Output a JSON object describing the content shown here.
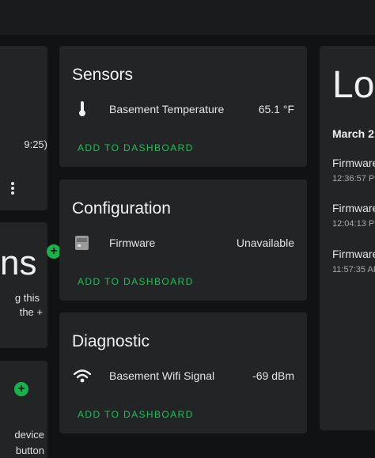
{
  "left": {
    "time_fragment": "9:25)",
    "big_text_fragment": "ns",
    "line1": "g this",
    "line2": "the +",
    "line3": "device",
    "line4": "button"
  },
  "sensors": {
    "title": "Sensors",
    "entity_label": "Basement Temperature",
    "entity_value": "65.1 °F",
    "icon": "thermometer-icon",
    "add_label": "ADD TO DASHBOARD"
  },
  "configuration": {
    "title": "Configuration",
    "entity_label": "Firmware",
    "entity_value": "Unavailable",
    "icon": "firmware-icon",
    "add_label": "ADD TO DASHBOARD"
  },
  "diagnostic": {
    "title": "Diagnostic",
    "entity_label": "Basement Wifi Signal",
    "entity_value": "-69 dBm",
    "icon": "wifi-icon",
    "add_label": "ADD TO DASHBOARD"
  },
  "logbook": {
    "title_fragment": "Lo",
    "date_fragment": "March 2",
    "entries": [
      {
        "name": "Firmware",
        "time": "12:36:57 PI"
      },
      {
        "name": "Firmware",
        "time": "12:04:13 PI"
      },
      {
        "name": "Firmware",
        "time": "11:57:35 AI"
      }
    ]
  },
  "colors": {
    "background": "#111213",
    "card": "#222425",
    "accent": "#18c158"
  }
}
